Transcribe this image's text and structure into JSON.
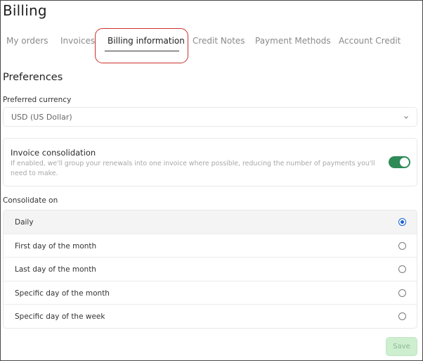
{
  "page": {
    "title": "Billing"
  },
  "tabs": [
    {
      "label": "My orders"
    },
    {
      "label": "Invoices"
    },
    {
      "label": "Billing information",
      "active": true
    },
    {
      "label": "Credit Notes"
    },
    {
      "label": "Payment Methods"
    },
    {
      "label": "Account Credit"
    }
  ],
  "preferences": {
    "title": "Preferences",
    "currency_label": "Preferred currency",
    "currency_value": "USD (US Dollar)",
    "consolidation": {
      "title": "Invoice consolidation",
      "description": "If enabled, we'll group your renewals into one invoice where possible, reducing the number of payments you'll need to make.",
      "enabled": true
    },
    "consolidate_on_label": "Consolidate on",
    "consolidate_options": [
      {
        "label": "Daily",
        "selected": true
      },
      {
        "label": "First day of the month",
        "selected": false
      },
      {
        "label": "Last day of the month",
        "selected": false
      },
      {
        "label": "Specific day of the month",
        "selected": false
      },
      {
        "label": "Specific day of the week",
        "selected": false
      }
    ],
    "save_label": "Save"
  },
  "colors": {
    "toggle_on": "#2e8b57",
    "radio_selected": "#1a62d6",
    "highlight_ring": "#c9302c",
    "save_disabled_bg": "#cdeecf"
  }
}
